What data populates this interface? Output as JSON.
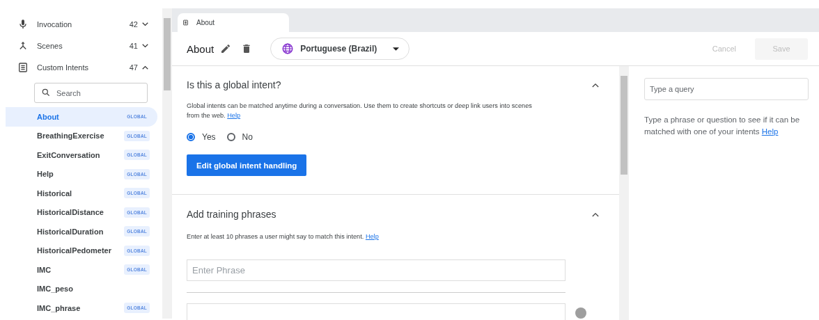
{
  "nav": [
    {
      "kind": "mic",
      "label": "Invocation",
      "count": "42",
      "expanded": false
    },
    {
      "kind": "merge",
      "label": "Scenes",
      "count": "41",
      "expanded": false
    },
    {
      "kind": "list",
      "label": "Custom Intents",
      "count": "47",
      "expanded": true
    }
  ],
  "search": {
    "placeholder": "Search"
  },
  "intents": [
    {
      "name": "About",
      "badge": "GLOBAL",
      "selected": true
    },
    {
      "name": "BreathingExercise",
      "badge": "GLOBAL",
      "selected": false
    },
    {
      "name": "ExitConversation",
      "badge": "GLOBAL",
      "selected": false
    },
    {
      "name": "Help",
      "badge": "GLOBAL",
      "selected": false
    },
    {
      "name": "Historical",
      "badge": "GLOBAL",
      "selected": false
    },
    {
      "name": "HistoricalDistance",
      "badge": "GLOBAL",
      "selected": false
    },
    {
      "name": "HistoricalDuration",
      "badge": "GLOBAL",
      "selected": false
    },
    {
      "name": "HistoricalPedometer",
      "badge": "GLOBAL",
      "selected": false
    },
    {
      "name": "IMC",
      "badge": "GLOBAL",
      "selected": false
    },
    {
      "name": "IMC_peso",
      "selected": false
    },
    {
      "name": "IMC_phrase",
      "badge": "GLOBAL",
      "selected": false
    }
  ],
  "tab": {
    "label": "About"
  },
  "header": {
    "title": "About",
    "language": "Portuguese (Brazil)",
    "cancel": "Cancel",
    "save": "Save"
  },
  "global_section": {
    "title": "Is this a global intent?",
    "expanded": true,
    "description": "Global intents can be matched anytime during a conversation. Use them to create shortcuts or deep link users into scenes from the web.",
    "help": "Help",
    "options": [
      {
        "label": "Yes",
        "selected": true
      },
      {
        "label": "No",
        "selected": false
      }
    ],
    "button": "Edit global intent handling"
  },
  "training_section": {
    "title": "Add training phrases",
    "expanded": true,
    "description": "Enter at least 10 phrases a user might say to match this intent.",
    "help": "Help",
    "placeholder": "Enter Phrase"
  },
  "test_panel": {
    "placeholder": "Type a query",
    "description": "Type a phrase or question to see if it can be matched with one of your intents",
    "help": "Help"
  }
}
